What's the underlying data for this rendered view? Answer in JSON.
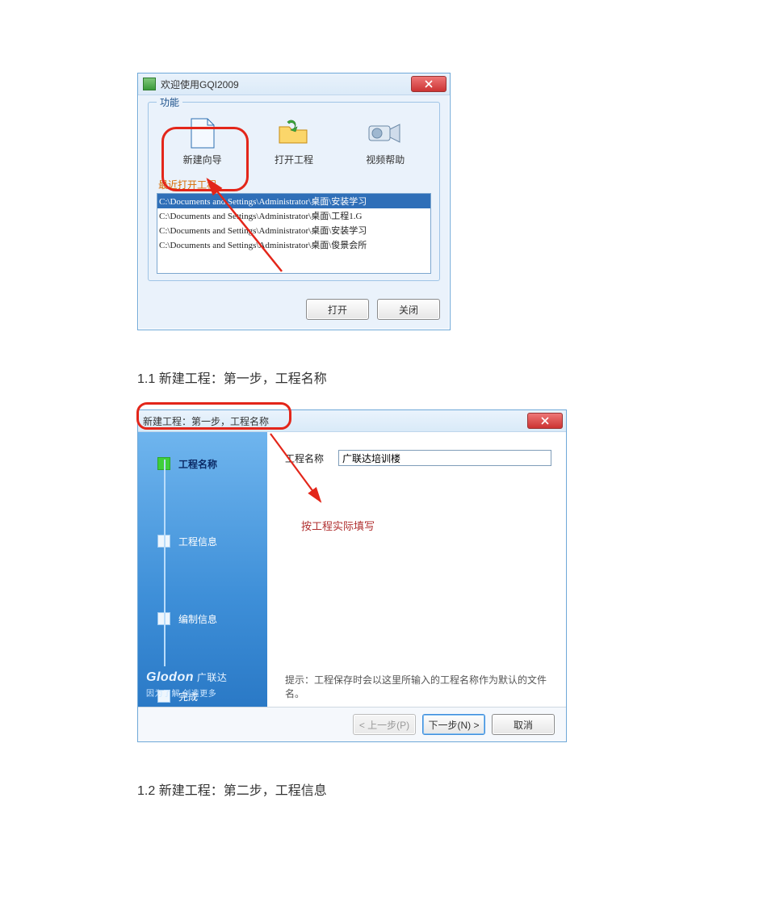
{
  "dlg1": {
    "title": "欢迎使用GQI2009",
    "group_legend": "功能",
    "items": [
      {
        "label": "新建向导"
      },
      {
        "label": "打开工程"
      },
      {
        "label": "视频帮助"
      }
    ],
    "recent_legend": "最近打开工程",
    "recent": [
      "C:\\Documents and Settings\\Administrator\\桌面\\安装学习",
      "C:\\Documents and Settings\\Administrator\\桌面\\工程1.G",
      "C:\\Documents and Settings\\Administrator\\桌面\\安装学习",
      "C:\\Documents and Settings\\Administrator\\桌面\\俊景会所"
    ],
    "open": "打开",
    "close": "关闭"
  },
  "caption1": "1.1 新建工程：第一步，工程名称",
  "dlg2": {
    "title": "新建工程：第一步，工程名称",
    "steps": [
      "工程名称",
      "工程信息",
      "编制信息",
      "完成"
    ],
    "brand_main": "Glodon",
    "brand_cn": "广联达",
    "brand_sub": "因为了解 创造更多",
    "field_label": "工程名称",
    "field_value": "广联达培训楼",
    "redtext": "按工程实际填写",
    "hint": "提示：工程保存时会以这里所输入的工程名称作为默认的文件名。",
    "prev": "< 上一步(P)",
    "next": "下一步(N) >",
    "cancel": "取消"
  },
  "caption2": "1.2 新建工程：第二步，工程信息"
}
